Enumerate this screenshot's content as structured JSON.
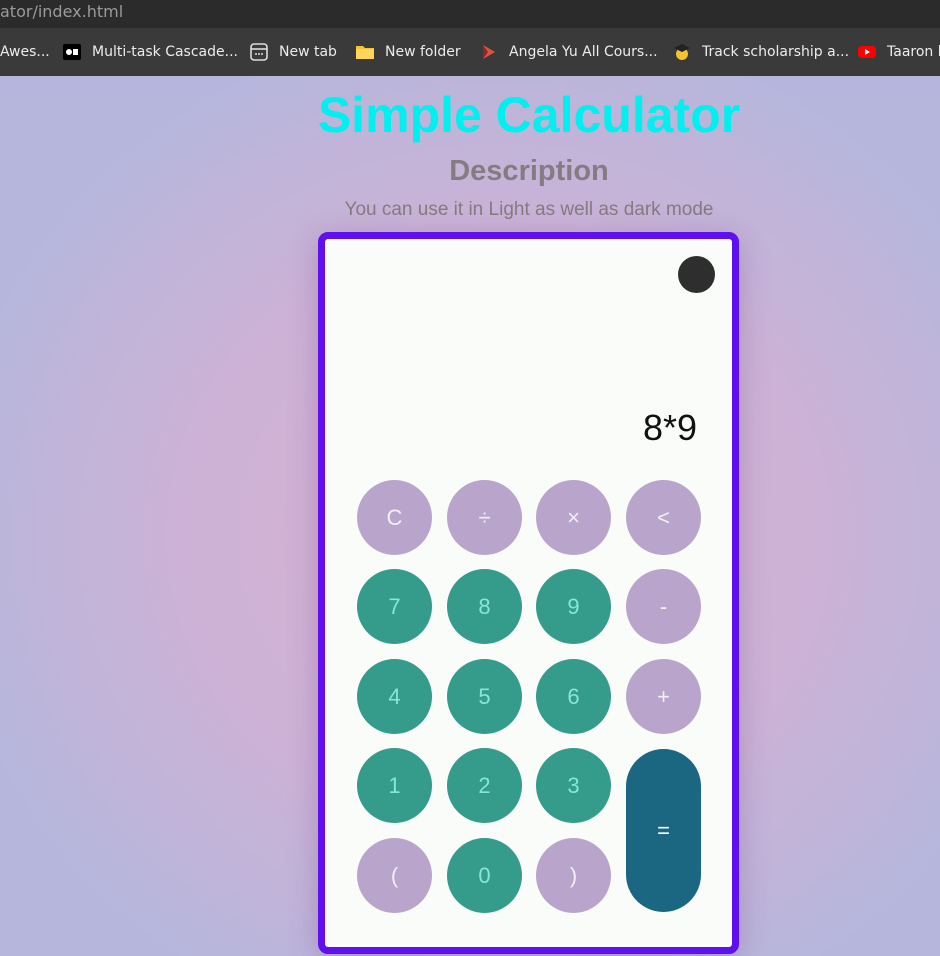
{
  "browser": {
    "url": "ator/index.html",
    "bookmarks": [
      {
        "label": "Awes...",
        "icon": "none"
      },
      {
        "label": "Multi-task Cascade...",
        "icon": "video-icon"
      },
      {
        "label": "New tab",
        "icon": "new-tab-icon"
      },
      {
        "label": "New folder",
        "icon": "folder-icon"
      },
      {
        "label": "Angela Yu All Cours...",
        "icon": "udemy-icon"
      },
      {
        "label": "Track scholarship a...",
        "icon": "graduate-icon"
      },
      {
        "label": "Taaron k",
        "icon": "youtube-icon"
      }
    ]
  },
  "page": {
    "title": "Simple Calculator",
    "subtitle": "Description",
    "description": "You can use it in Light as well as dark mode"
  },
  "calculator": {
    "display": "8*9",
    "buttons": {
      "clear": "C",
      "divide": "÷",
      "multiply": "×",
      "backspace": "<",
      "seven": "7",
      "eight": "8",
      "nine": "9",
      "minus": "-",
      "four": "4",
      "five": "5",
      "six": "6",
      "plus": "+",
      "one": "1",
      "two": "2",
      "three": "3",
      "equals": "=",
      "open_paren": "(",
      "zero": "0",
      "close_paren": ")"
    },
    "colors": {
      "border": "#6010ee",
      "operator": "#b9a5cb",
      "number": "#359b8a",
      "equals": "#1b6680",
      "title": "#00f0f0"
    }
  }
}
